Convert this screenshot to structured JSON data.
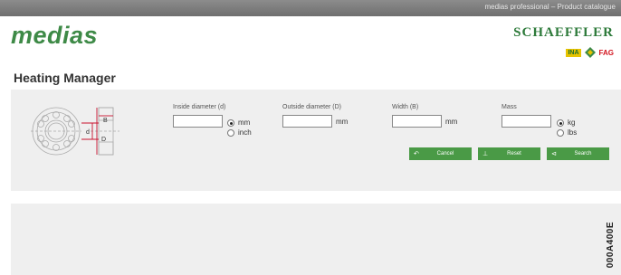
{
  "topbar": {
    "title": "medias professional – Product catalogue"
  },
  "header": {
    "logo": "medias",
    "brand": "SCHAEFFLER",
    "sub_brands": [
      "INA",
      "FAG"
    ]
  },
  "page": {
    "title": "Heating Manager"
  },
  "diagram": {
    "labels": [
      "B",
      "d",
      "D"
    ]
  },
  "fields": [
    {
      "label": "Inside diameter (d)",
      "value": "",
      "units": [
        "mm",
        "inch"
      ],
      "selected": "mm"
    },
    {
      "label": "Outside diameter (D)",
      "value": "",
      "unit": "mm"
    },
    {
      "label": "Width (B)",
      "value": "",
      "unit": "mm"
    },
    {
      "label": "Mass",
      "value": "",
      "units": [
        "kg",
        "lbs"
      ],
      "selected": "kg"
    }
  ],
  "buttons": [
    {
      "label": "Cancel",
      "icon": "undo-icon",
      "glyph": "↶"
    },
    {
      "label": "Reset",
      "icon": "reset-icon",
      "glyph": "⊥"
    },
    {
      "label": "Search",
      "icon": "search-arrow-icon",
      "glyph": "⊲"
    }
  ],
  "figure_code": "000A400E",
  "colors": {
    "brand_green": "#3e8a47",
    "button_green": "#4a9a46",
    "fag_red": "#d2141e",
    "ina_yellow": "#e7c300"
  }
}
